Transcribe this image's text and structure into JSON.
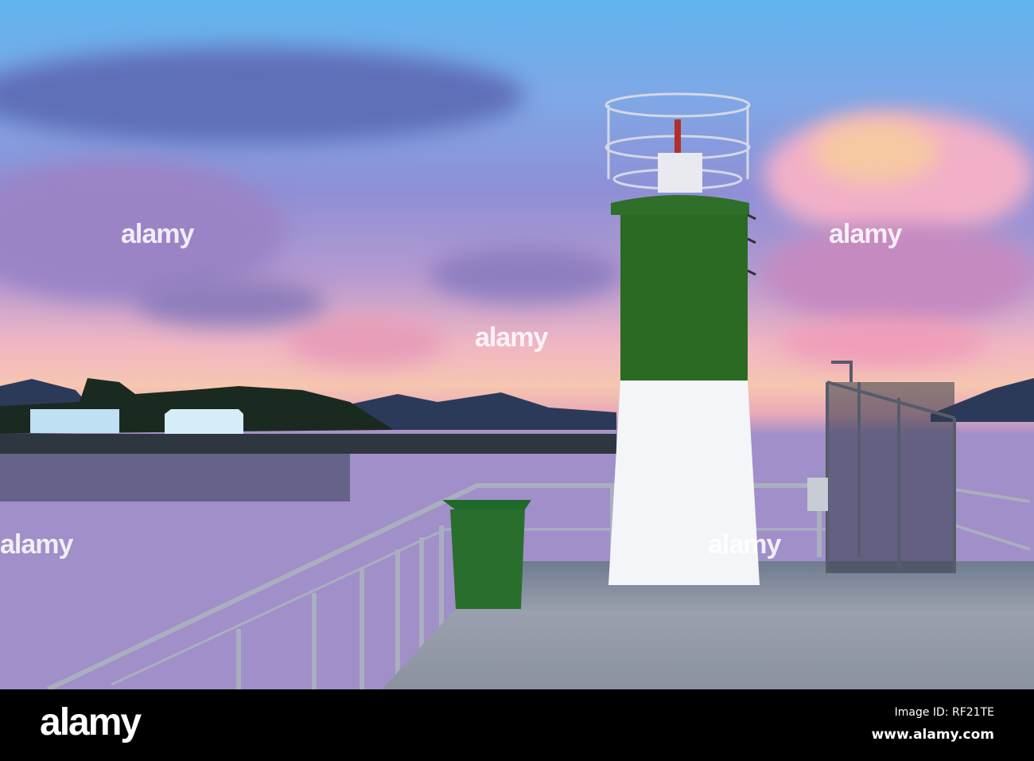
{
  "footer": {
    "logo": "alamy",
    "image_id": "Image ID: RF21TE",
    "website": "www.alamy.com"
  },
  "watermark": "alamy"
}
